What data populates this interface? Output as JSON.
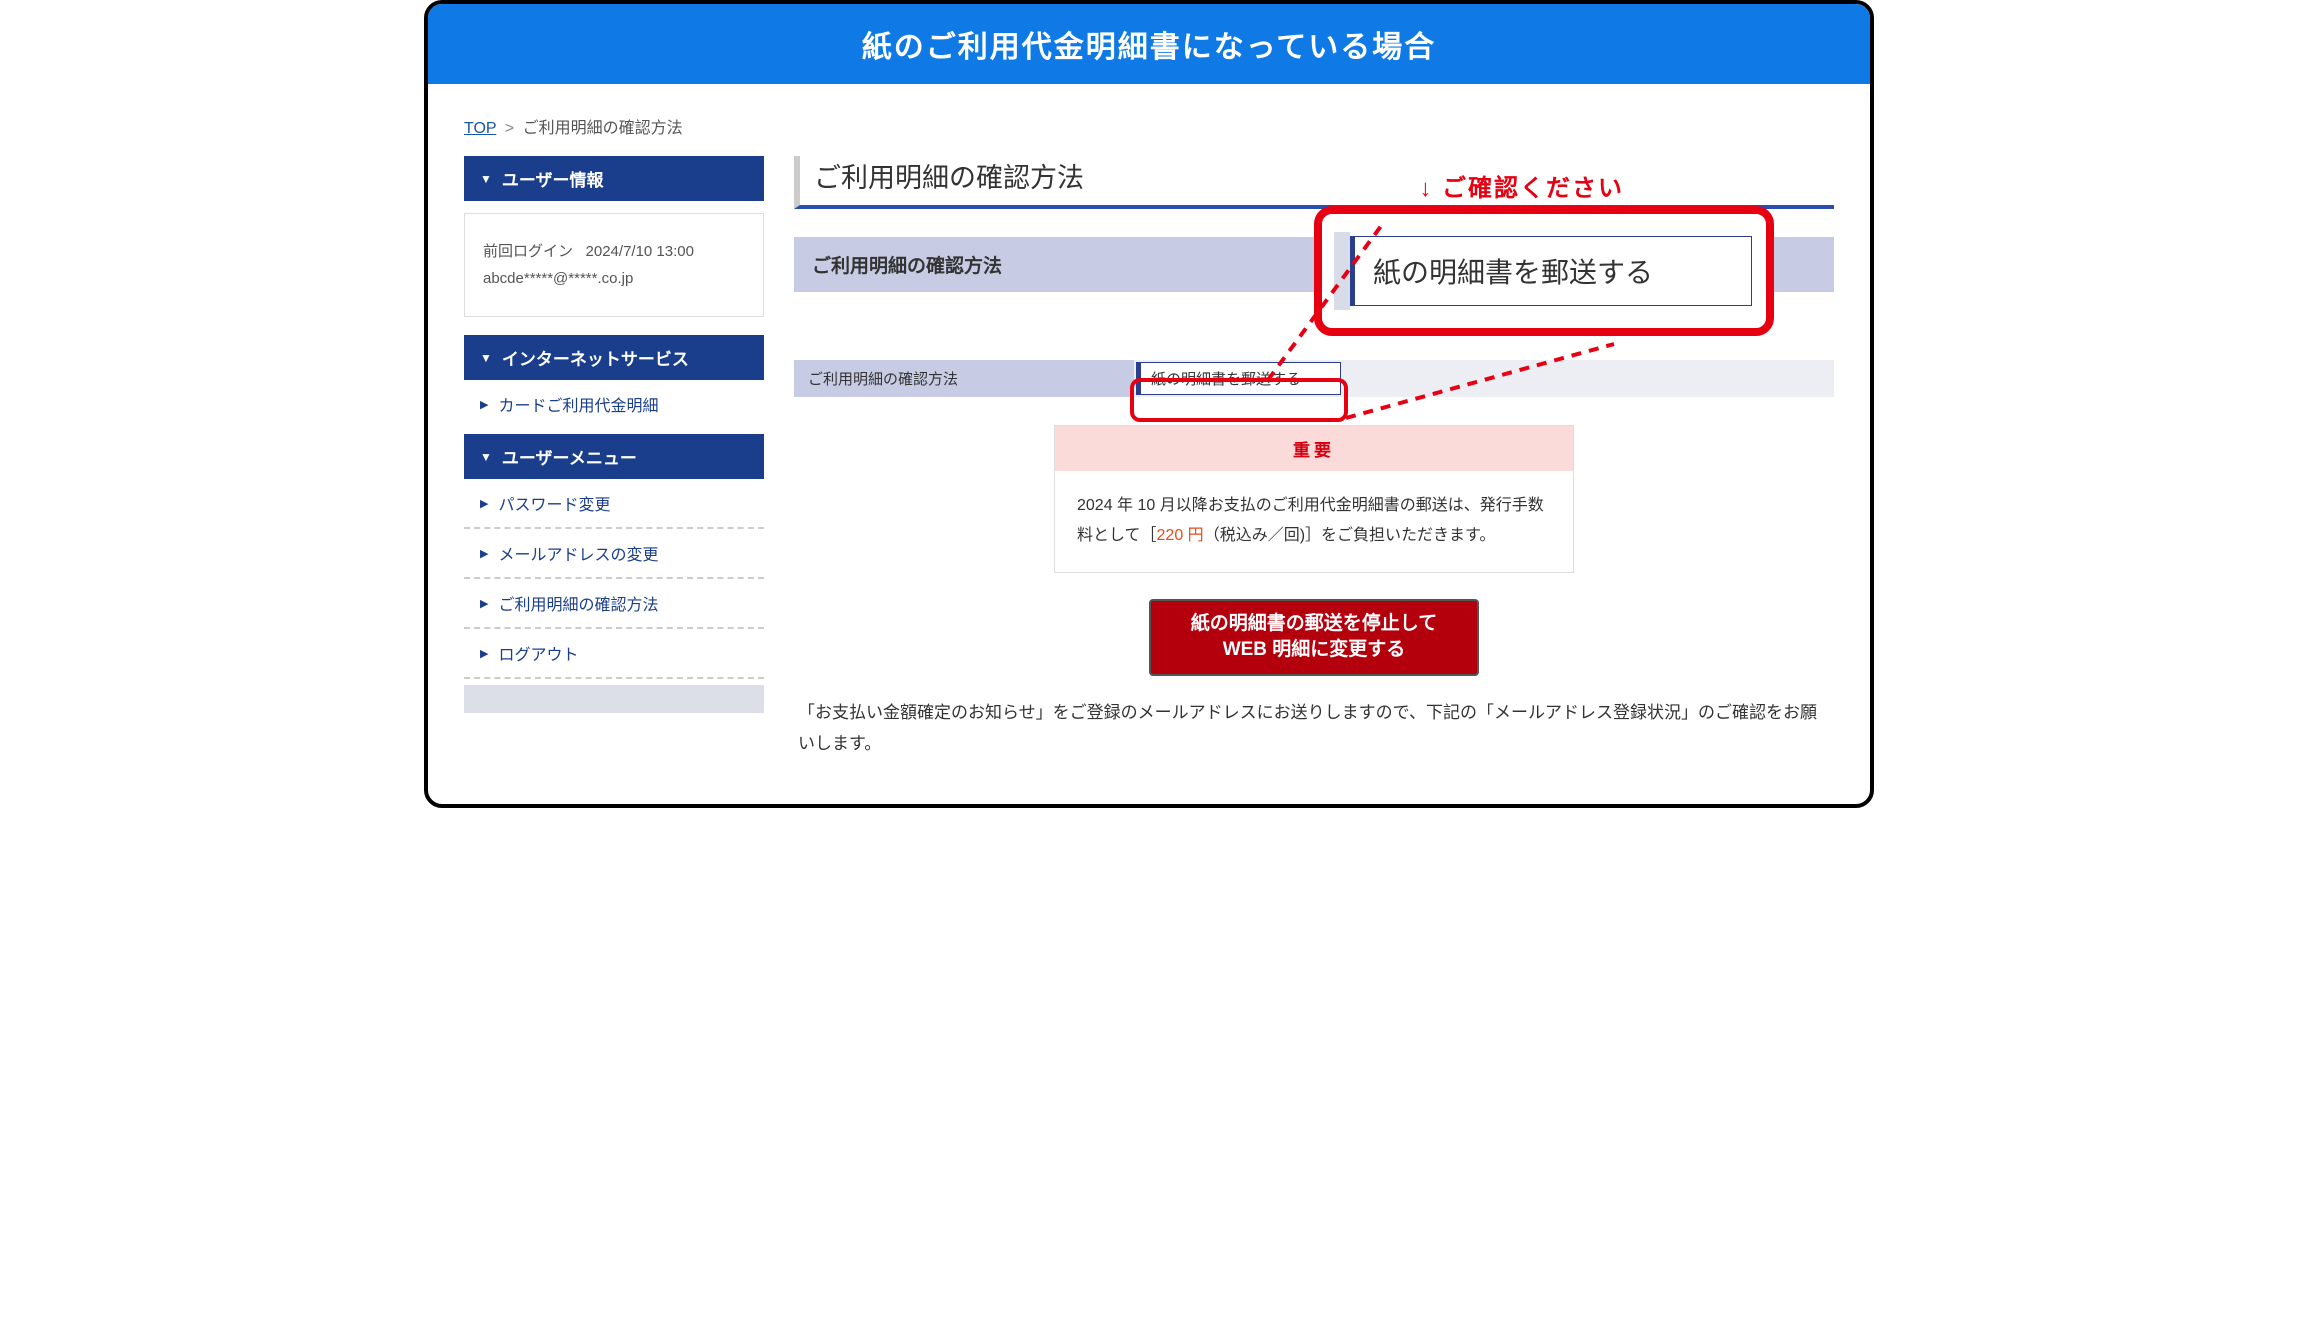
{
  "banner": "紙のご利用代金明細書になっている場合",
  "breadcrumb": {
    "top": "TOP",
    "current": "ご利用明細の確認方法"
  },
  "sidebar": {
    "user_header": "ユーザー情報",
    "last_login_label": "前回ログイン",
    "last_login_value": "2024/7/10 13:00",
    "email_masked": "abcde*****@*****.co.jp",
    "internet_header": "インターネットサービス",
    "item_statement": "カードご利用代金明細",
    "menu_header": "ユーザーメニュー",
    "item_password": "パスワード変更",
    "item_email": "メールアドレスの変更",
    "item_confirm": "ご利用明細の確認方法",
    "item_logout": "ログアウト"
  },
  "main": {
    "page_title": "ご利用明細の確認方法",
    "section_bar": "ご利用明細の確認方法",
    "detail_label": "ご利用明細の確認方法",
    "detail_value": "紙の明細書を郵送する",
    "notice_head": "重要",
    "notice_pre": "2024 年 10 月以降お支払のご利用代金明細書の郵送は、発行手数料として［",
    "notice_fee": "220 円",
    "notice_post": "（税込み／回)］をご負担いただきます。",
    "cta_line1": "紙の明細書の郵送を停止して",
    "cta_line2": "WEB 明細に変更する",
    "foot_note": "「お支払い金額確定のお知らせ」をご登録のメールアドレスにお送りしますので、下記の「メールアドレス登録状況」のご確認をお願いします。"
  },
  "callout": {
    "label": "↓ ご確認ください",
    "text": "紙の明細書を郵送する"
  }
}
